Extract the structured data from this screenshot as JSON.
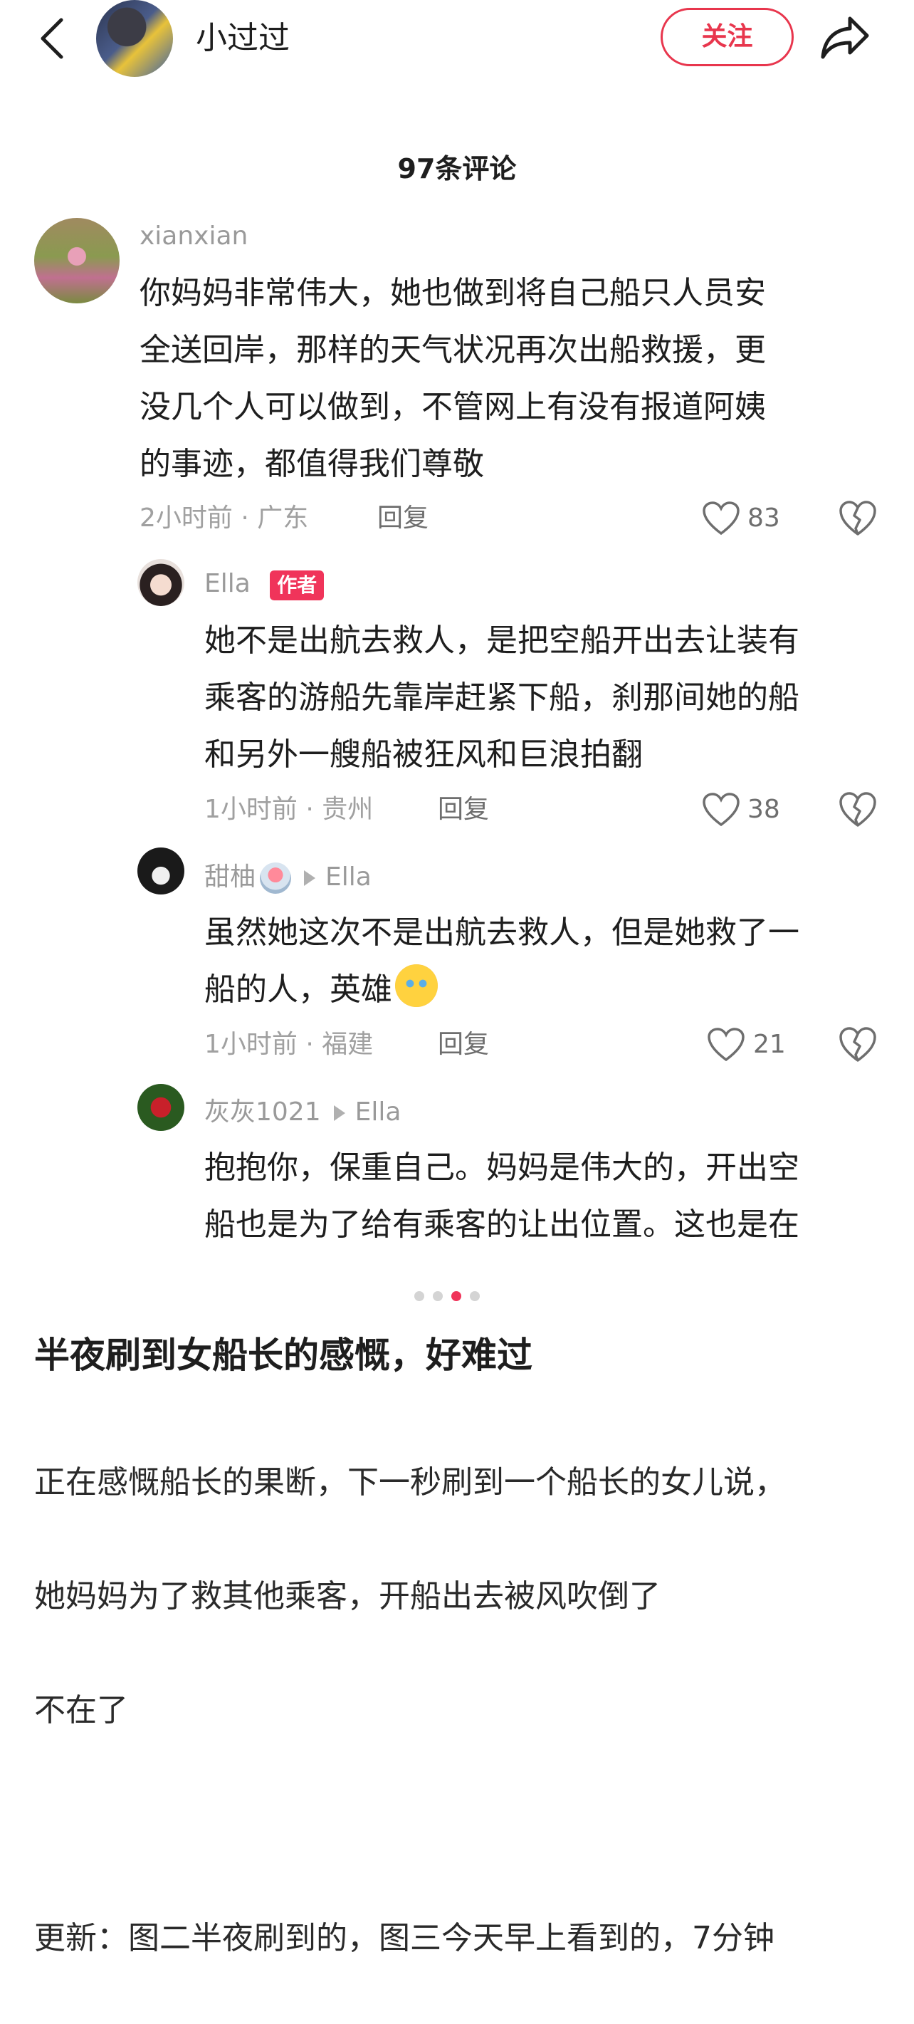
{
  "header": {
    "author_name": "小过过",
    "follow_label": "关注"
  },
  "comments_title": "97条评论",
  "comments": [
    {
      "user": "xianxian",
      "lines": [
        "你妈妈非常伟大，她也做到将自己船只人员安",
        "全送回岸，那样的天气状况再次出船救援，更",
        "没几个人可以做到，不管网上有没有报道阿姨",
        "的事迹，都值得我们尊敬"
      ],
      "meta": "2小时前 · 广东",
      "reply_label": "回复",
      "likes": "83"
    },
    {
      "user": "Ella",
      "author_tag": "作者",
      "lines": [
        "她不是出航去救人，是把空船开出去让装有",
        "乘客的游船先靠岸赶紧下船，刹那间她的船",
        "和另外一艘船被狂风和巨浪拍翻"
      ],
      "meta": "1小时前 · 贵州",
      "reply_label": "回复",
      "likes": "38"
    },
    {
      "user": "甜柚",
      "reply_to": "Ella",
      "lines": [
        "虽然她这次不是出航去救人，但是她救了一",
        "船的人，英雄"
      ],
      "meta": "1小时前 · 福建",
      "reply_label": "回复",
      "likes": "21"
    },
    {
      "user": "灰灰1021",
      "reply_to": "Ella",
      "lines": [
        "抱抱你，保重自己。妈妈是伟大的，开出空",
        "船也是为了给有乘客的让出位置。这也是在"
      ]
    }
  ],
  "carousel": {
    "count": 4,
    "active_index": 2
  },
  "post": {
    "title": "半夜刷到女船长的感慨，好难过",
    "body_lines": [
      "正在感慨船长的果断，下一秒刷到一个船长的女儿说，",
      "她妈妈为了救其他乘客，开船出去被风吹倒了",
      "不在了",
      "",
      "更新：图二半夜刷到的，图三今天早上看到的，7分钟"
    ]
  },
  "colors": {
    "accent": "#f0345a",
    "follow": "#e8364d",
    "meta": "#a0a0a0"
  },
  "icons": [
    "back-icon",
    "share-icon",
    "heart-icon",
    "broken-heart-icon"
  ]
}
